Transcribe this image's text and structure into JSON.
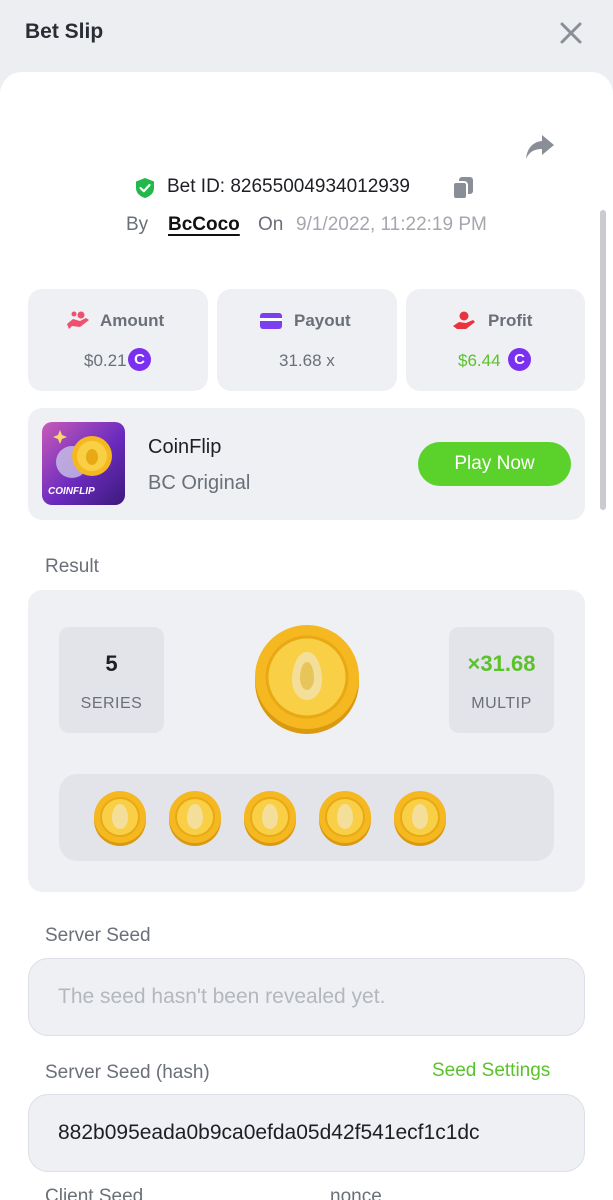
{
  "header": {
    "title": "Bet Slip",
    "close_icon": "close-icon"
  },
  "bet": {
    "id_label": "Bet ID: 82655004934012939",
    "by_label": "By",
    "user": "BcCoco",
    "on_label": "On",
    "date": "9/1/2022, 11:22:19 PM"
  },
  "stats": {
    "amount": {
      "label": "Amount",
      "value": "$0.21",
      "icon": "hand-coins-icon"
    },
    "payout": {
      "label": "Payout",
      "value": "31.68 x",
      "icon": "wallet-card-icon"
    },
    "profit": {
      "label": "Profit",
      "value": "$6.44",
      "icon": "profit-hand-icon"
    },
    "currency_glyph": "C"
  },
  "game": {
    "name": "CoinFlip",
    "provider": "BC Original",
    "thumb_label": "COINFLIP",
    "play_label": "Play Now"
  },
  "result": {
    "section_label": "Result",
    "series_value": "5",
    "series_label": "SERIES",
    "multiplier_value": "×31.68",
    "multiplier_label": "MULTIP",
    "coin_count": 5
  },
  "server_seed": {
    "label": "Server Seed",
    "placeholder": "The seed hasn't been revealed yet."
  },
  "server_seed_hash": {
    "label": "Server Seed (hash)",
    "settings_link": "Seed Settings",
    "value": "882b095eada0b9ca0efda05d42f541ecf1c1dc"
  },
  "client_seed": {
    "label": "Client Seed"
  },
  "nonce": {
    "label": "nonce"
  },
  "colors": {
    "accent_green": "#5bd12b",
    "profit_green": "#5bc22b",
    "currency_purple": "#7b2ff0",
    "coin_gold": "#f5b820"
  }
}
